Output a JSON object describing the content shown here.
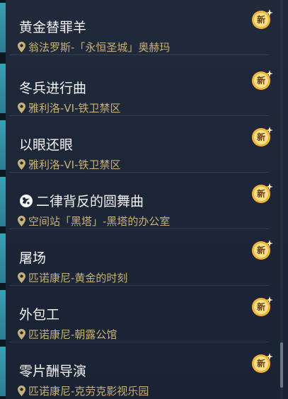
{
  "badge_label": "新",
  "colors": {
    "accent": "#3aa0b4",
    "title": "#f2f2f2",
    "location": "#c8b078",
    "badge": "#f3c04a"
  },
  "quests": [
    {
      "title": "黄金替罪羊",
      "location": "翁法罗斯-「永恒圣城」奥赫玛",
      "icon": null,
      "is_new": true
    },
    {
      "title": "冬兵进行曲",
      "location": "雅利洛-VI-铁卫禁区",
      "icon": null,
      "is_new": true
    },
    {
      "title": "以眼还眼",
      "location": "雅利洛-VI-铁卫禁区",
      "icon": null,
      "is_new": true
    },
    {
      "title": "二律背反的圆舞曲",
      "location": "空间站「黑塔」-黑塔的办公室",
      "icon": "companion-quest-icon",
      "is_new": true
    },
    {
      "title": "屠场",
      "location": "匹诺康尼-黄金的时刻",
      "icon": null,
      "is_new": true
    },
    {
      "title": "外包工",
      "location": "匹诺康尼-朝露公馆",
      "icon": null,
      "is_new": true
    },
    {
      "title": "零片酬导演",
      "location": "匹诺康尼-克劳克影视乐园",
      "icon": null,
      "is_new": true
    }
  ]
}
